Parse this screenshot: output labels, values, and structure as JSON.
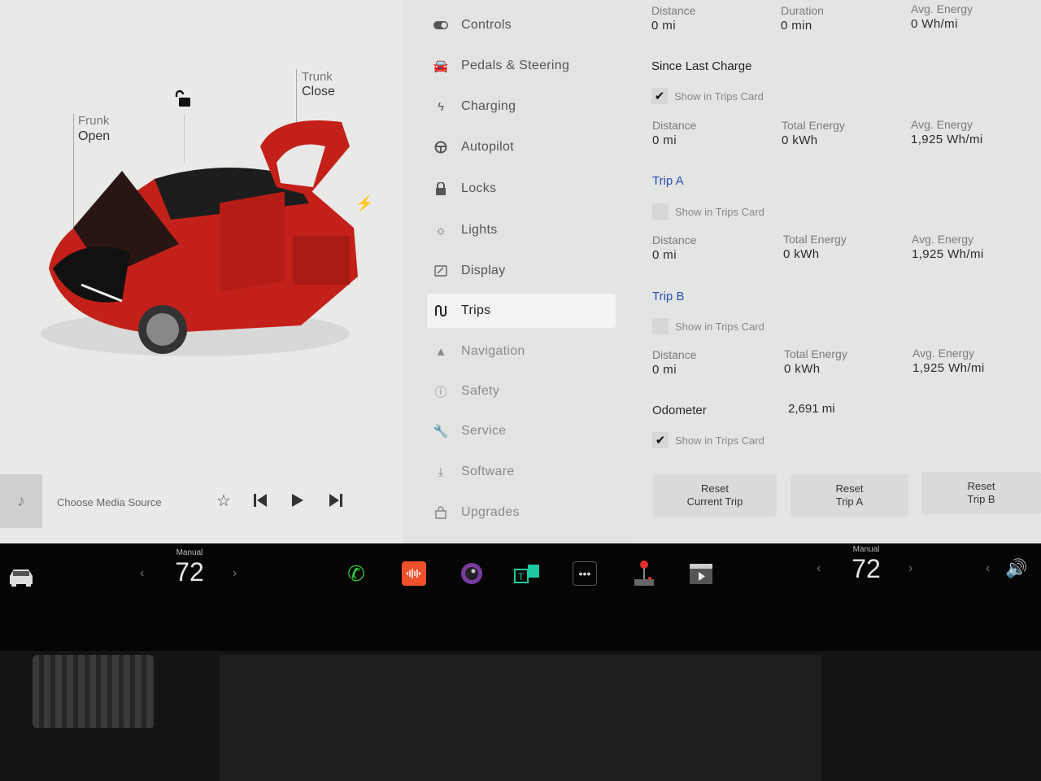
{
  "car_view": {
    "frunk": {
      "label": "Frunk",
      "state": "Open"
    },
    "trunk": {
      "label": "Trunk",
      "state": "Close"
    },
    "lock_state": "unlocked",
    "charge_port_icon": "bolt-icon",
    "car_color": "#c4201a"
  },
  "media": {
    "source_label": "Choose Media Source",
    "icons": [
      "music-note-icon",
      "star-icon",
      "previous-track-icon",
      "play-icon",
      "next-track-icon"
    ]
  },
  "nav": {
    "items": [
      {
        "label": "Controls",
        "icon": "toggle-icon"
      },
      {
        "label": "Pedals & Steering",
        "icon": "car-icon"
      },
      {
        "label": "Charging",
        "icon": "bolt-icon"
      },
      {
        "label": "Autopilot",
        "icon": "steering-wheel-icon"
      },
      {
        "label": "Locks",
        "icon": "lock-icon"
      },
      {
        "label": "Lights",
        "icon": "light-icon"
      },
      {
        "label": "Display",
        "icon": "display-icon"
      },
      {
        "label": "Trips",
        "icon": "trips-icon",
        "active": true
      },
      {
        "label": "Navigation",
        "icon": "navigation-icon"
      },
      {
        "label": "Safety",
        "icon": "safety-icon"
      },
      {
        "label": "Service",
        "icon": "wrench-icon"
      },
      {
        "label": "Software",
        "icon": "download-icon"
      },
      {
        "label": "Upgrades",
        "icon": "bag-icon"
      }
    ]
  },
  "trips": {
    "current": {
      "distance": {
        "label": "Distance",
        "value": "0 mi"
      },
      "duration": {
        "label": "Duration",
        "value": "0 min"
      },
      "avg_energy": {
        "label": "Avg. Energy",
        "value": "0 Wh/mi"
      }
    },
    "since_last_charge": {
      "title": "Since Last Charge",
      "show_in_card": {
        "label": "Show in Trips Card",
        "checked": true
      },
      "distance": {
        "label": "Distance",
        "value": "0 mi"
      },
      "total_energy": {
        "label": "Total Energy",
        "value": "0 kWh"
      },
      "avg_energy": {
        "label": "Avg. Energy",
        "value": "1,925 Wh/mi"
      }
    },
    "trip_a": {
      "title": "Trip A",
      "show_in_card": {
        "label": "Show in Trips Card",
        "checked": false
      },
      "distance": {
        "label": "Distance",
        "value": "0 mi"
      },
      "total_energy": {
        "label": "Total Energy",
        "value": "0 kWh"
      },
      "avg_energy": {
        "label": "Avg. Energy",
        "value": "1,925 Wh/mi"
      }
    },
    "trip_b": {
      "title": "Trip B",
      "show_in_card": {
        "label": "Show in Trips Card",
        "checked": false
      },
      "distance": {
        "label": "Distance",
        "value": "0 mi"
      },
      "total_energy": {
        "label": "Total Energy",
        "value": "0 kWh"
      },
      "avg_energy": {
        "label": "Avg. Energy",
        "value": "1,925 Wh/mi"
      }
    },
    "odometer": {
      "label": "Odometer",
      "value": "2,691 mi",
      "show_in_card": {
        "label": "Show in Trips Card",
        "checked": true
      }
    },
    "buttons": {
      "reset_current": [
        "Reset",
        "Current Trip"
      ],
      "reset_a": [
        "Reset",
        "Trip A"
      ],
      "reset_b": [
        "Reset",
        "Trip B"
      ]
    }
  },
  "taskbar": {
    "driver_temp": {
      "mode": "Manual",
      "value": "72"
    },
    "passenger_temp": {
      "mode": "Manual",
      "value": "72"
    },
    "apps": [
      "phone-icon",
      "audio-icon",
      "camera-icon",
      "toybox-icon",
      "more-apps-icon",
      "arcade-icon",
      "theater-icon"
    ],
    "colors": {
      "phone": "#2ecc40",
      "audio": "#f0502a",
      "camera": "#7a3ca0",
      "toybox": "#1ec8a0"
    }
  }
}
